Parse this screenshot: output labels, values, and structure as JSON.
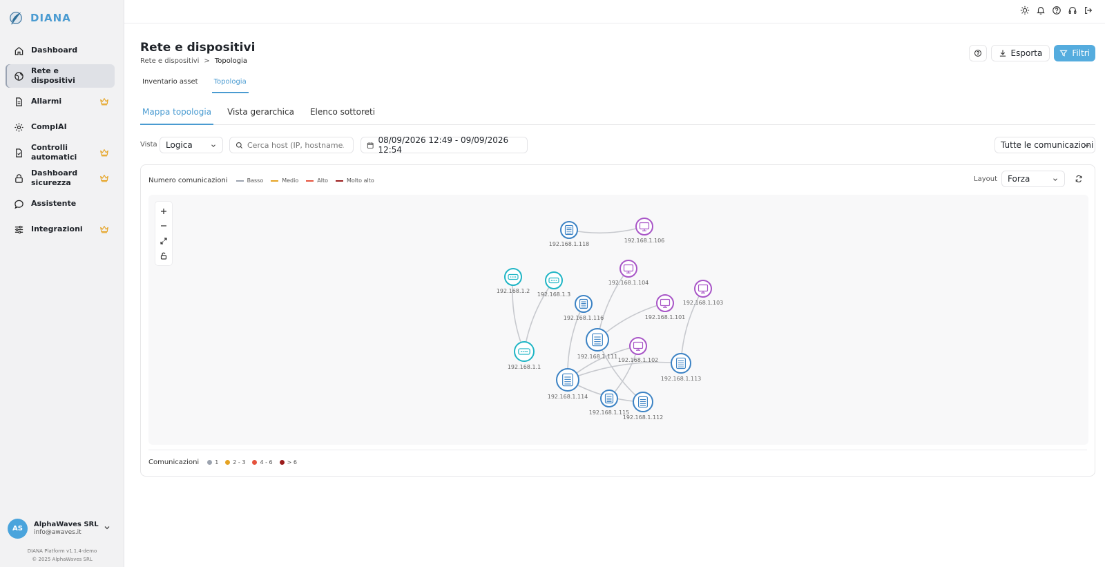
{
  "app": {
    "brand": "DIANA"
  },
  "sidebar": {
    "items": [
      {
        "label": "Dashboard",
        "icon": "home-icon",
        "premium": false,
        "active": false
      },
      {
        "label": "Rete e dispositivi",
        "icon": "network-icon",
        "premium": false,
        "active": true
      },
      {
        "label": "Allarmi",
        "icon": "document-alert-icon",
        "premium": true,
        "active": false
      },
      {
        "label": "CompIAI",
        "icon": "gear-icon",
        "premium": false,
        "active": false
      },
      {
        "label": "Controlli automatici",
        "icon": "document-check-icon",
        "premium": true,
        "active": false
      },
      {
        "label": "Dashboard sicurezza",
        "icon": "lock-icon",
        "premium": true,
        "active": false
      },
      {
        "label": "Assistente",
        "icon": "chat-icon",
        "premium": false,
        "active": false
      },
      {
        "label": "Integrazioni",
        "icon": "sliders-icon",
        "premium": true,
        "active": false
      }
    ],
    "account": {
      "initials": "AS",
      "name": "AlphaWaves SRL",
      "email": "info@awaves.it"
    },
    "footer": {
      "version": "DIANA Platform v1.1.4-demo",
      "copyright": "© 2025 AlphaWaves SRL"
    }
  },
  "topbar": {
    "icons": [
      "sun-icon",
      "bell-icon",
      "help-icon",
      "headset-icon",
      "logout-icon"
    ]
  },
  "header": {
    "title": "Rete e dispositivi",
    "breadcrumb": [
      "Rete e dispositivi",
      ">",
      "Topologia"
    ],
    "export_label": "Esporta",
    "filter_label": "Filtri"
  },
  "tabs": [
    {
      "label": "Inventario asset",
      "active": false
    },
    {
      "label": "Topologia",
      "active": true
    }
  ],
  "subtabs": [
    {
      "label": "Mappa topologia",
      "active": true
    },
    {
      "label": "Vista gerarchica",
      "active": false
    },
    {
      "label": "Elenco sottoreti",
      "active": false
    }
  ],
  "filters": {
    "vista_label": "Vista",
    "vista_value": "Logica",
    "search_placeholder": "Cerca host (IP, hostname...)",
    "date_range": "08/09/2026 12:49 - 09/09/2026 12:54",
    "comm_value": "Tutte le comunicazioni"
  },
  "map": {
    "legend_title": "Numero comunicazioni",
    "legend": [
      {
        "label": "Basso",
        "color": "#9ca3af"
      },
      {
        "label": "Medio",
        "color": "#e5a323"
      },
      {
        "label": "Alto",
        "color": "#e5533d"
      },
      {
        "label": "Molto alto",
        "color": "#9b1c1c"
      }
    ],
    "layout_label": "Layout",
    "layout_value": "Forza",
    "bottom_legend_title": "Comunicazioni",
    "bottom_legend": [
      {
        "label": "1",
        "color": "#9ca3af"
      },
      {
        "label": "2 - 3",
        "color": "#e5a323"
      },
      {
        "label": "4 - 6",
        "color": "#e5533d"
      },
      {
        "label": "> 6",
        "color": "#9b1c1c"
      }
    ],
    "colors": {
      "server": "#3b82c4",
      "workstation": "#a855c7",
      "switch": "#1fb5c5"
    },
    "nodes": [
      {
        "id": "192.168.1.118",
        "type": "server"
      },
      {
        "id": "192.168.1.106",
        "type": "workstation"
      },
      {
        "id": "192.168.1.2",
        "type": "switch"
      },
      {
        "id": "192.168.1.3",
        "type": "switch"
      },
      {
        "id": "192.168.1.104",
        "type": "workstation"
      },
      {
        "id": "192.168.1.103",
        "type": "workstation"
      },
      {
        "id": "192.168.1.116",
        "type": "server"
      },
      {
        "id": "192.168.1.101",
        "type": "workstation"
      },
      {
        "id": "192.168.1.111",
        "type": "server"
      },
      {
        "id": "192.168.1.1",
        "type": "switch"
      },
      {
        "id": "192.168.1.102",
        "type": "workstation"
      },
      {
        "id": "192.168.1.113",
        "type": "server"
      },
      {
        "id": "192.168.1.114",
        "type": "server"
      },
      {
        "id": "192.168.1.115",
        "type": "server"
      },
      {
        "id": "192.168.1.112",
        "type": "server"
      }
    ],
    "edges": [
      [
        "192.168.1.118",
        "192.168.1.106"
      ],
      [
        "192.168.1.2",
        "192.168.1.1"
      ],
      [
        "192.168.1.3",
        "192.168.1.1"
      ],
      [
        "192.168.1.104",
        "192.168.1.111"
      ],
      [
        "192.168.1.101",
        "192.168.1.111"
      ],
      [
        "192.168.1.116",
        "192.168.1.114"
      ],
      [
        "192.168.1.111",
        "192.168.1.112"
      ],
      [
        "192.168.1.102",
        "192.168.1.114"
      ],
      [
        "192.168.1.103",
        "192.168.1.113"
      ],
      [
        "192.168.1.113",
        "192.168.1.114"
      ],
      [
        "192.168.1.114",
        "192.168.1.112"
      ],
      [
        "192.168.1.115",
        "192.168.1.102"
      ]
    ]
  }
}
